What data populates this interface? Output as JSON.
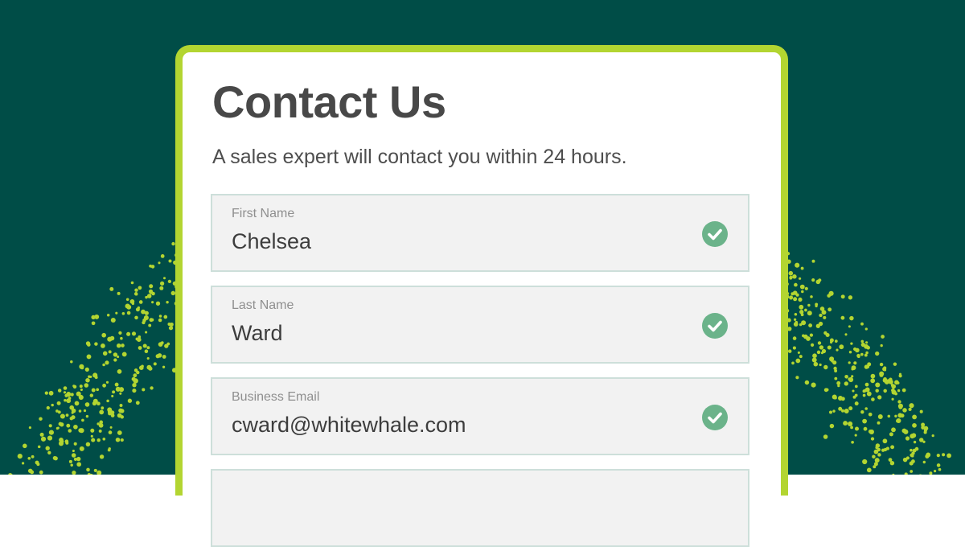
{
  "colors": {
    "background": "#004d47",
    "accent": "#b3d531",
    "check": "#6bb38a"
  },
  "card": {
    "title": "Contact Us",
    "subtitle": "A sales expert will contact you within 24 hours."
  },
  "fields": [
    {
      "label": "First Name",
      "value": "Chelsea",
      "status_icon": "check-circle-icon"
    },
    {
      "label": "Last Name",
      "value": "Ward",
      "status_icon": "check-circle-icon"
    },
    {
      "label": "Business Email",
      "value": "cward@whitewhale.com",
      "status_icon": "check-circle-icon"
    }
  ]
}
